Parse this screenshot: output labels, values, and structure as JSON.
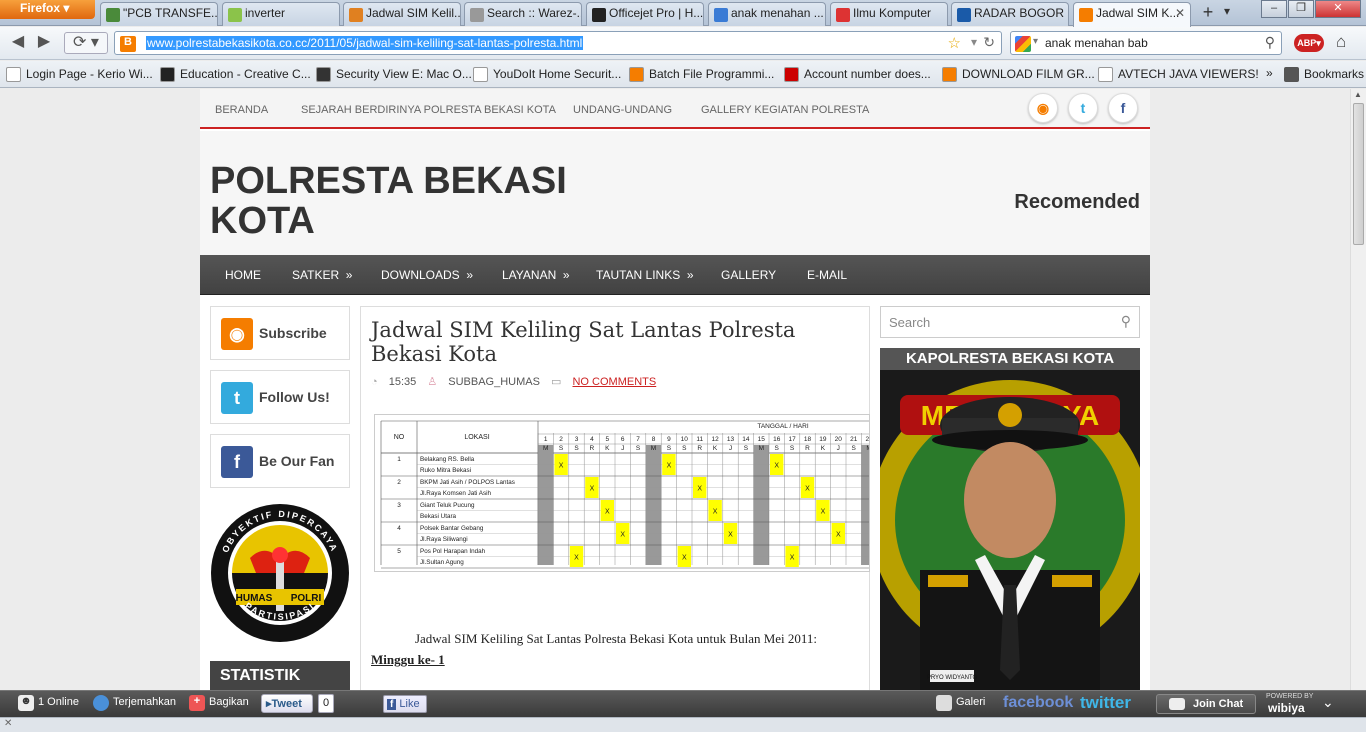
{
  "browser": {
    "app_menu": "Firefox",
    "tabs": [
      {
        "label": "\"PCB TRANSFE...",
        "color": "#4a8a3a"
      },
      {
        "label": "inverter",
        "color": "#8bc34a"
      },
      {
        "label": "Jadwal SIM Kelil...",
        "color": "#e08020"
      },
      {
        "label": "Search :: Warez-...",
        "color": "#999999"
      },
      {
        "label": "Officejet Pro | H...",
        "color": "#222222"
      },
      {
        "label": "anak menahan ...",
        "color": "#3a7bd5"
      },
      {
        "label": "Ilmu Komputer",
        "color": "#d33"
      },
      {
        "label": "RADAR BOGOR ...",
        "color": "#1a5aa8"
      },
      {
        "label": "Jadwal SIM K...",
        "color": "#f57d00"
      }
    ],
    "url": "www.polrestabekasikota.co.cc/2011/05/jadwal-sim-keliling-sat-lantas-polresta.html",
    "search_value": "anak  menahan bab",
    "bookmarks": [
      {
        "label": "Login Page - Kerio Wi...",
        "color": "#fff"
      },
      {
        "label": "Education - Creative C...",
        "color": "#222"
      },
      {
        "label": "Security View E: Mac O...",
        "color": "#333"
      },
      {
        "label": "YouDoIt Home Securit...",
        "color": "#fff"
      },
      {
        "label": "Batch File Programmi...",
        "color": "#f57d00"
      },
      {
        "label": "Account number does...",
        "color": "#c00"
      },
      {
        "label": "DOWNLOAD FILM GR...",
        "color": "#f57d00"
      },
      {
        "label": "AVTECH JAVA VIEWERS!",
        "color": "#fff"
      }
    ],
    "bookmarks_menu": "Bookmarks"
  },
  "site": {
    "top_menu": [
      "BERANDA",
      "SEJARAH BERDIRINYA POLRESTA BEKASI KOTA",
      "UNDANG-UNDANG",
      "GALLERY KEGIATAN POLRESTA"
    ],
    "title": "POLRESTA BEKASI KOTA",
    "recomended": "Recomended",
    "main_menu": [
      {
        "label": "HOME",
        "arrow": ""
      },
      {
        "label": "SATKER",
        "arrow": "»"
      },
      {
        "label": "DOWNLOADS",
        "arrow": "»"
      },
      {
        "label": "LAYANAN",
        "arrow": "»"
      },
      {
        "label": "TAUTAN LINKS",
        "arrow": "»"
      },
      {
        "label": "GALLERY",
        "arrow": ""
      },
      {
        "label": "E-MAIL",
        "arrow": ""
      }
    ],
    "sidebar_left": {
      "subscribe": "Subscribe",
      "follow": "Follow Us!",
      "fan": "Be Our Fan",
      "statistik": "STATISTIK",
      "logo_top": "OBYEKTIF DIPERCAYA",
      "logo_mid_left": "HUMAS",
      "logo_mid_right": "POLRI",
      "logo_bottom": "PARTISIPASI"
    },
    "post": {
      "title": "Jadwal SIM Keliling Sat Lantas Polresta Bekasi Kota",
      "time": "15:35",
      "author": "SUBBAG_HUMAS",
      "comments": "NO COMMENTS",
      "intro": "Jadwal SIM Keliling Sat Lantas Polresta Bekasi Kota untuk Bulan Mei 2011:",
      "week": "Minggu ke- 1"
    },
    "schedule": {
      "col_no": "NO",
      "col_lokasi": "LOKASI",
      "col_tanggal": "TANGGAL / HARI",
      "days": [
        "M",
        "S",
        "S",
        "R",
        "K",
        "J",
        "S",
        "M",
        "S",
        "S",
        "R",
        "K",
        "J",
        "S",
        "M",
        "S",
        "S",
        "R",
        "K",
        "J",
        "S",
        "M"
      ],
      "rows": [
        {
          "no": "1",
          "loc1": "Belakang RS. Bella",
          "loc2": "Ruko Mitra Bekasi",
          "marks": [
            1,
            8,
            15
          ]
        },
        {
          "no": "2",
          "loc1": "BKPM Jati Asih / POLPOS Lantas",
          "loc2": "Jl.Raya Komsen Jati Asih",
          "marks": [
            3,
            10,
            17
          ]
        },
        {
          "no": "3",
          "loc1": "Giant Teluk Pucung",
          "loc2": "Bekasi Utara",
          "marks": [
            4,
            11,
            18
          ]
        },
        {
          "no": "4",
          "loc1": "Polsek Bantar Gebang",
          "loc2": "Jl.Raya Siliwangi",
          "marks": [
            5,
            12,
            19
          ]
        },
        {
          "no": "5",
          "loc1": "Pos Pol Harapan Indah",
          "loc2": "Jl.Sultan Agung",
          "marks": [
            2,
            9,
            16
          ]
        }
      ],
      "sunday_cols": [
        0,
        7,
        14,
        21
      ],
      "mark": "X"
    },
    "sidebar_right": {
      "search_placeholder": "Search",
      "kapolresta": "KAPOLRESTA BEKASI KOTA",
      "photo_badge": "METRO JAYA",
      "name_tag": "PRYO WIDYANTO"
    }
  },
  "bottom_bar": {
    "online": "1 Online",
    "translate": "Terjemahkan",
    "share": "Bagikan",
    "tweet": "Tweet",
    "tweet_count": "0",
    "like": "Like",
    "gallery": "Galeri",
    "facebook": "facebook",
    "twitter": "twitter",
    "join_chat": "Join Chat",
    "powered": "POWERED BY",
    "wibiya": "wibiya"
  }
}
